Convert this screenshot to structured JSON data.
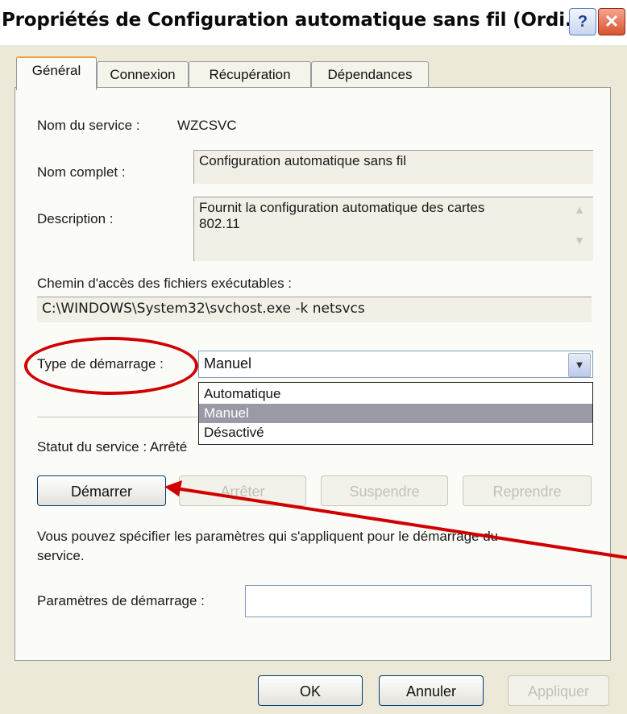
{
  "window": {
    "title": "Propriétés de Configuration automatique sans fil (Ordi...",
    "help_button": "?",
    "close_button": "✕"
  },
  "tabs": [
    {
      "label": "Général"
    },
    {
      "label": "Connexion"
    },
    {
      "label": "Récupération"
    },
    {
      "label": "Dépendances"
    }
  ],
  "general": {
    "service_name_label": "Nom du service :",
    "service_name_value": "WZCSVC",
    "full_name_label": "Nom complet :",
    "full_name_value": "Configuration automatique sans fil",
    "description_label": "Description :",
    "description_value_line1": "Fournit la configuration automatique des cartes",
    "description_value_line2": "802.11",
    "exe_path_label": "Chemin d'accès des fichiers exécutables :",
    "exe_path_value": "C:\\WINDOWS\\System32\\svchost.exe -k netsvcs",
    "startup_type_label": "Type de démarrage :",
    "startup_type_value": "Manuel",
    "startup_options": [
      "Automatique",
      "Manuel",
      "Désactivé"
    ],
    "service_status_label": "Statut du service : Arrêté",
    "buttons": {
      "start": "Démarrer",
      "stop": "Arrêter",
      "pause": "Suspendre",
      "resume": "Reprendre"
    },
    "hint_line1": "Vous pouvez spécifier les paramètres qui s'appliquent pour le démarrage du",
    "hint_line2": "service.",
    "start_params_label": "Paramètres de démarrage :",
    "start_params_value": ""
  },
  "footer": {
    "ok": "OK",
    "cancel": "Annuler",
    "apply": "Appliquer"
  },
  "icons": {
    "combo_arrow": "chevron-down-icon",
    "scroll_up": "scroll-up-icon",
    "scroll_down": "scroll-down-icon"
  },
  "annotation_color": "#d00000"
}
